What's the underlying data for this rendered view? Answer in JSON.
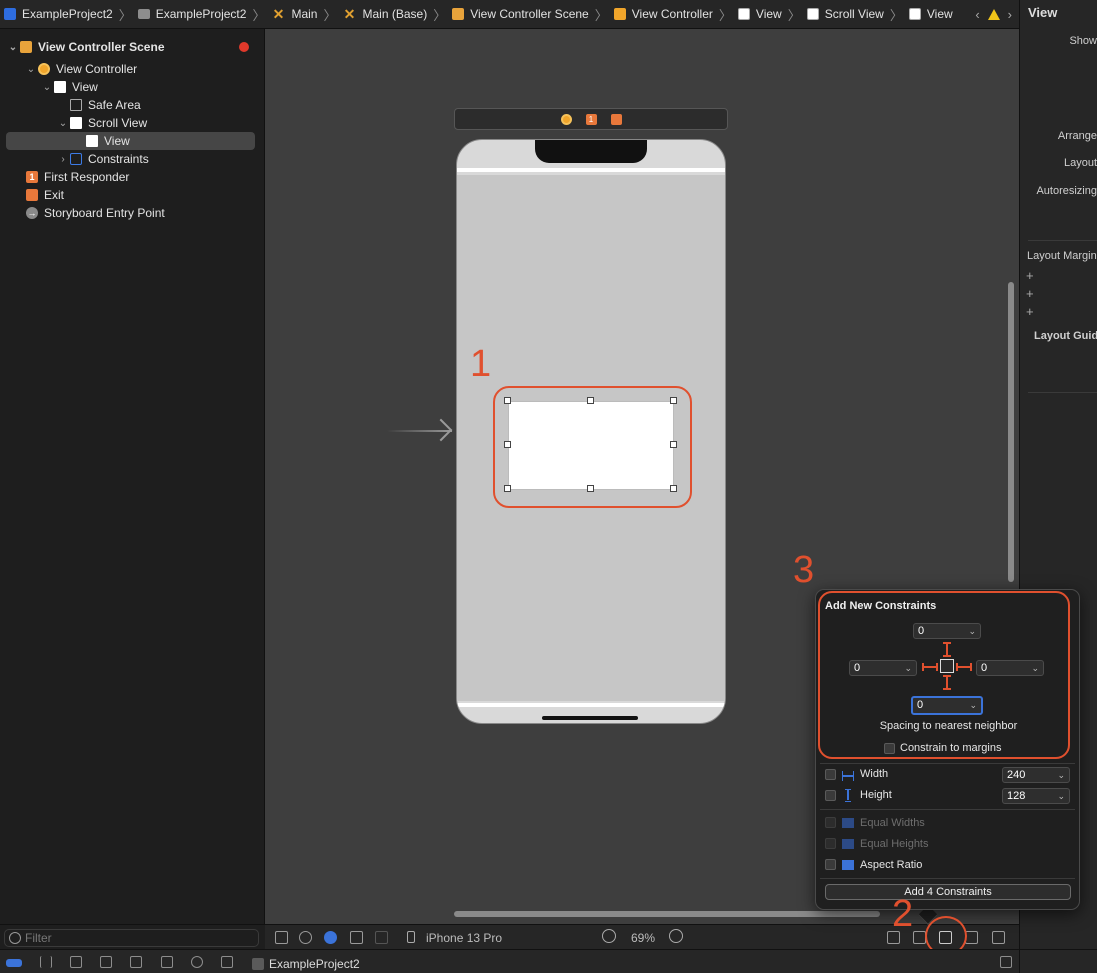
{
  "breadcrumb": [
    {
      "label": "ExampleProject2",
      "icon": "project-icon"
    },
    {
      "label": "ExampleProject2",
      "icon": "folder-icon"
    },
    {
      "label": "Main",
      "icon": "storyboard-icon"
    },
    {
      "label": "Main (Base)",
      "icon": "storyboard-icon"
    },
    {
      "label": "View Controller Scene",
      "icon": "scene-icon"
    },
    {
      "label": "View Controller",
      "icon": "view-controller-icon"
    },
    {
      "label": "View",
      "icon": "view-icon"
    },
    {
      "label": "Scroll View",
      "icon": "scroll-view-icon"
    },
    {
      "label": "View",
      "icon": "view-icon"
    }
  ],
  "outline": {
    "items": [
      {
        "label": "View Controller Scene"
      },
      {
        "label": "View Controller"
      },
      {
        "label": "View"
      },
      {
        "label": "Safe Area"
      },
      {
        "label": "Scroll View"
      },
      {
        "label": "View"
      },
      {
        "label": "Constraints"
      },
      {
        "label": "First Responder"
      },
      {
        "label": "Exit"
      },
      {
        "label": "Storyboard Entry Point"
      }
    ],
    "first_responder_badge": "1",
    "filter_placeholder": "Filter"
  },
  "canvas": {
    "annotations": [
      "1",
      "2",
      "3"
    ],
    "device": "iPhone 13 Pro",
    "zoom": "69%"
  },
  "inspector": {
    "title": "View",
    "lines": [
      "Show",
      "Arrange",
      "Layout",
      "Autoresizing",
      "Layout Margins",
      "Layout Guide"
    ]
  },
  "popover": {
    "title": "Add New Constraints",
    "top_value": "0",
    "left_value": "0",
    "right_value": "0",
    "bottom_value": "0",
    "spacing_label": "Spacing to nearest neighbor",
    "margins_label": "Constrain to margins",
    "width_label": "Width",
    "width_value": "240",
    "height_label": "Height",
    "height_value": "128",
    "equal_widths_label": "Equal Widths",
    "equal_heights_label": "Equal Heights",
    "aspect_ratio_label": "Aspect Ratio",
    "add_button_label": "Add 4 Constraints"
  },
  "debugbar": {
    "target": "ExampleProject2"
  },
  "colors": {
    "annotation": "#e0502e",
    "accent": "#3b73d9"
  }
}
